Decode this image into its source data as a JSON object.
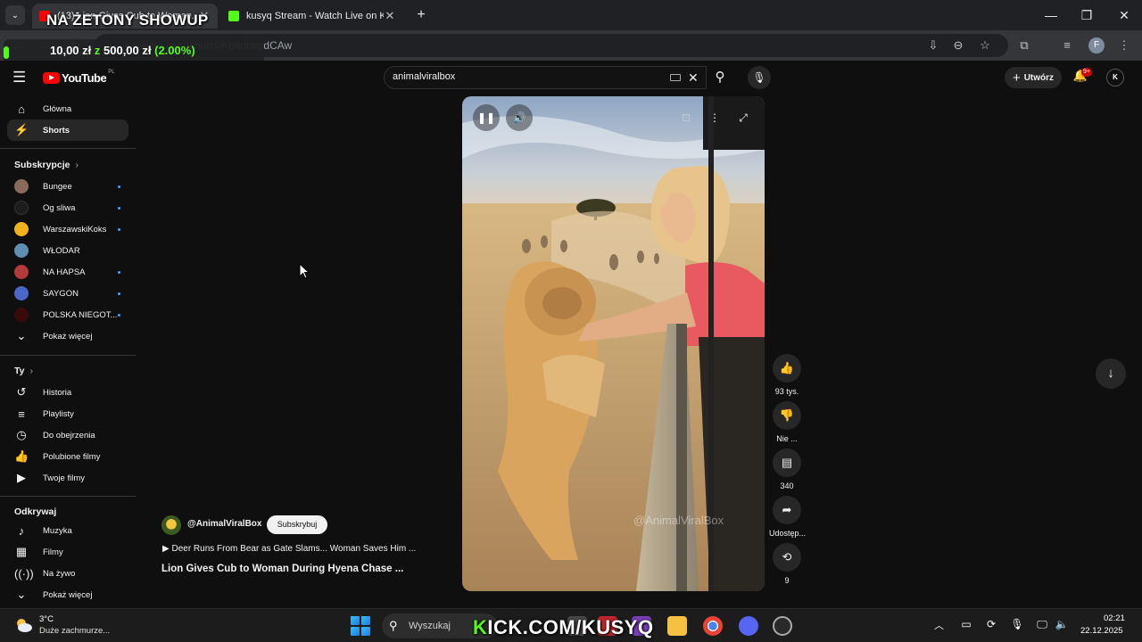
{
  "browser": {
    "tabs": [
      {
        "title": "(13) Lion Gives Cub to Woman...",
        "favicon_color": "#ff0000",
        "active": true
      },
      {
        "title": "kusyq Stream - Watch Live on K",
        "favicon_color": "#53fc18",
        "active": false
      }
    ],
    "url": "youtube.com/shorts/Kp8nbkgdCAw",
    "profile_initial": "F"
  },
  "overlay": {
    "title": "NA ŻETONY SHOWUP",
    "goal_current": "10,00 zł",
    "goal_sep": " z ",
    "goal_target": "500,00 zł",
    "goal_percent": "(2.00%)",
    "accent": "#53fc18"
  },
  "youtube": {
    "logo_text": "YouTube",
    "country": "PL",
    "search_value": "animalviralbox",
    "create_label": "Utwórz",
    "notifications_badge": "9+",
    "account_initial": "K"
  },
  "sidebar": {
    "main": [
      {
        "label": "Główna",
        "icon": "home-icon"
      },
      {
        "label": "Shorts",
        "icon": "shorts-icon"
      }
    ],
    "subs_header": "Subskrypcje",
    "subs": [
      {
        "label": "Bungee",
        "avatar": "#8a6a5a"
      },
      {
        "label": "Og sliwa",
        "avatar": "#1c1c1c"
      },
      {
        "label": "WarszawskiKoks",
        "avatar": "#f3b21b"
      },
      {
        "label": "WŁODAR",
        "avatar": "#5d8fb3"
      },
      {
        "label": "NA HAPSA",
        "avatar": "#b23a3a"
      },
      {
        "label": "SAYGON",
        "avatar": "#4a67c7"
      },
      {
        "label": "POLSKA NIEGOT...",
        "avatar": "#3a0a0a"
      }
    ],
    "show_more": "Pokaż więcej",
    "you_header": "Ty",
    "you": [
      {
        "label": "Historia",
        "icon": "history-icon"
      },
      {
        "label": "Playlisty",
        "icon": "playlists-icon"
      },
      {
        "label": "Do obejrzenia",
        "icon": "watch-later-icon"
      },
      {
        "label": "Polubione filmy",
        "icon": "liked-icon"
      },
      {
        "label": "Twoje filmy",
        "icon": "your-videos-icon"
      }
    ],
    "explore_header": "Odkrywaj",
    "explore": [
      {
        "label": "Muzyka",
        "icon": "music-icon"
      },
      {
        "label": "Filmy",
        "icon": "movies-icon"
      },
      {
        "label": "Na żywo",
        "icon": "live-icon"
      }
    ],
    "show_more_2": "Pokaż więcej"
  },
  "short": {
    "watermark": "@AnimalViralBox",
    "channel": "@AnimalViralBox",
    "subscribe_label": "Subskrybuj",
    "related": "Deer Runs From Bear as Gate Slams... Woman Saves Him ...",
    "title": "Lion Gives Cub to Woman During Hyena Chase ...",
    "actions": {
      "likes": "93 tys.",
      "dislike": "Nie ...",
      "comments": "340",
      "share": "Udostęp...",
      "remix": "9"
    }
  },
  "taskbar": {
    "temp": "3°C",
    "weather": "Duże zachmurze...",
    "search": "Wyszukaj",
    "banner_k": "K",
    "banner_rest": "ICK.COM/KUSYQ",
    "time": "02:21",
    "date": "22.12.2025"
  }
}
